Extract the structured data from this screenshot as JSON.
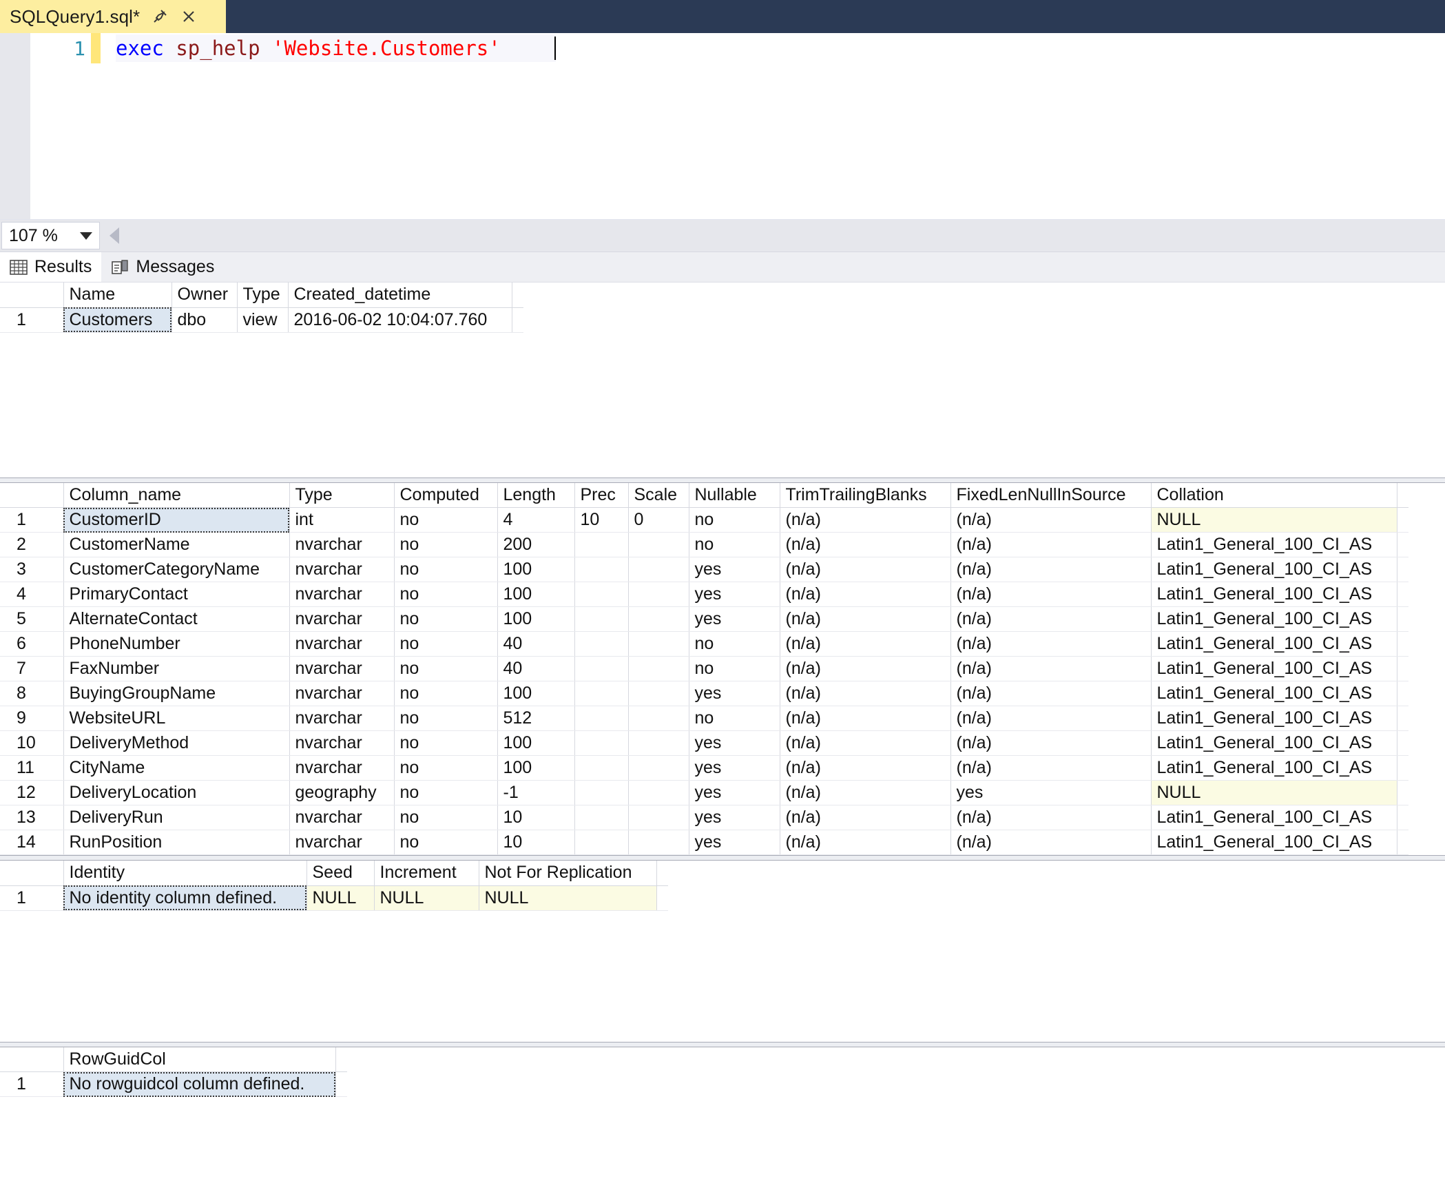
{
  "tab": {
    "title": "SQLQuery1.sql*",
    "pin_icon": "pin-icon",
    "close_icon": "close-icon"
  },
  "editor": {
    "line_number": "1",
    "code": {
      "keyword": "exec",
      "procedure": "sp_help",
      "string": "'Website.Customers'"
    }
  },
  "zoom_bar": {
    "zoom_value": "107 %",
    "dropdown_icon": "chevron-down-icon",
    "splitter_icon": "left-arrow-icon"
  },
  "result_tabs": [
    {
      "label": "Results",
      "icon": "grid-icon",
      "selected": true
    },
    {
      "label": "Messages",
      "icon": "messages-icon",
      "selected": false
    }
  ],
  "grids": [
    {
      "name": "object-info-grid",
      "headers": [
        "",
        "Name",
        "Owner",
        "Type",
        "Created_datetime"
      ],
      "rows": [
        {
          "rownum": "1",
          "cells": [
            {
              "value": "Customers",
              "state": "selected"
            },
            {
              "value": "dbo",
              "state": "normal"
            },
            {
              "value": "view",
              "state": "normal"
            },
            {
              "value": "2016-06-02 10:04:07.760",
              "state": "normal"
            }
          ]
        }
      ]
    },
    {
      "name": "columns-grid",
      "headers": [
        "",
        "Column_name",
        "Type",
        "Computed",
        "Length",
        "Prec",
        "Scale",
        "Nullable",
        "TrimTrailingBlanks",
        "FixedLenNullInSource",
        "Collation"
      ],
      "rows": [
        {
          "rownum": "1",
          "cells": [
            {
              "value": "CustomerID",
              "state": "selected"
            },
            {
              "value": "int",
              "state": "normal"
            },
            {
              "value": "no",
              "state": "normal"
            },
            {
              "value": "4",
              "state": "normal"
            },
            {
              "value": "10",
              "state": "normal"
            },
            {
              "value": "0",
              "state": "normal"
            },
            {
              "value": "no",
              "state": "normal"
            },
            {
              "value": "(n/a)",
              "state": "normal"
            },
            {
              "value": "(n/a)",
              "state": "normal"
            },
            {
              "value": "NULL",
              "state": "null"
            }
          ]
        },
        {
          "rownum": "2",
          "cells": [
            {
              "value": "CustomerName",
              "state": "normal"
            },
            {
              "value": "nvarchar",
              "state": "normal"
            },
            {
              "value": "no",
              "state": "normal"
            },
            {
              "value": "200",
              "state": "normal"
            },
            {
              "value": "",
              "state": "normal"
            },
            {
              "value": "",
              "state": "normal"
            },
            {
              "value": "no",
              "state": "normal"
            },
            {
              "value": "(n/a)",
              "state": "normal"
            },
            {
              "value": "(n/a)",
              "state": "normal"
            },
            {
              "value": "Latin1_General_100_CI_AS",
              "state": "normal"
            }
          ]
        },
        {
          "rownum": "3",
          "cells": [
            {
              "value": "CustomerCategoryName",
              "state": "normal"
            },
            {
              "value": "nvarchar",
              "state": "normal"
            },
            {
              "value": "no",
              "state": "normal"
            },
            {
              "value": "100",
              "state": "normal"
            },
            {
              "value": "",
              "state": "normal"
            },
            {
              "value": "",
              "state": "normal"
            },
            {
              "value": "yes",
              "state": "normal"
            },
            {
              "value": "(n/a)",
              "state": "normal"
            },
            {
              "value": "(n/a)",
              "state": "normal"
            },
            {
              "value": "Latin1_General_100_CI_AS",
              "state": "normal"
            }
          ]
        },
        {
          "rownum": "4",
          "cells": [
            {
              "value": "PrimaryContact",
              "state": "normal"
            },
            {
              "value": "nvarchar",
              "state": "normal"
            },
            {
              "value": "no",
              "state": "normal"
            },
            {
              "value": "100",
              "state": "normal"
            },
            {
              "value": "",
              "state": "normal"
            },
            {
              "value": "",
              "state": "normal"
            },
            {
              "value": "yes",
              "state": "normal"
            },
            {
              "value": "(n/a)",
              "state": "normal"
            },
            {
              "value": "(n/a)",
              "state": "normal"
            },
            {
              "value": "Latin1_General_100_CI_AS",
              "state": "normal"
            }
          ]
        },
        {
          "rownum": "5",
          "cells": [
            {
              "value": "AlternateContact",
              "state": "normal"
            },
            {
              "value": "nvarchar",
              "state": "normal"
            },
            {
              "value": "no",
              "state": "normal"
            },
            {
              "value": "100",
              "state": "normal"
            },
            {
              "value": "",
              "state": "normal"
            },
            {
              "value": "",
              "state": "normal"
            },
            {
              "value": "yes",
              "state": "normal"
            },
            {
              "value": "(n/a)",
              "state": "normal"
            },
            {
              "value": "(n/a)",
              "state": "normal"
            },
            {
              "value": "Latin1_General_100_CI_AS",
              "state": "normal"
            }
          ]
        },
        {
          "rownum": "6",
          "cells": [
            {
              "value": "PhoneNumber",
              "state": "normal"
            },
            {
              "value": "nvarchar",
              "state": "normal"
            },
            {
              "value": "no",
              "state": "normal"
            },
            {
              "value": "40",
              "state": "normal"
            },
            {
              "value": "",
              "state": "normal"
            },
            {
              "value": "",
              "state": "normal"
            },
            {
              "value": "no",
              "state": "normal"
            },
            {
              "value": "(n/a)",
              "state": "normal"
            },
            {
              "value": "(n/a)",
              "state": "normal"
            },
            {
              "value": "Latin1_General_100_CI_AS",
              "state": "normal"
            }
          ]
        },
        {
          "rownum": "7",
          "cells": [
            {
              "value": "FaxNumber",
              "state": "normal"
            },
            {
              "value": "nvarchar",
              "state": "normal"
            },
            {
              "value": "no",
              "state": "normal"
            },
            {
              "value": "40",
              "state": "normal"
            },
            {
              "value": "",
              "state": "normal"
            },
            {
              "value": "",
              "state": "normal"
            },
            {
              "value": "no",
              "state": "normal"
            },
            {
              "value": "(n/a)",
              "state": "normal"
            },
            {
              "value": "(n/a)",
              "state": "normal"
            },
            {
              "value": "Latin1_General_100_CI_AS",
              "state": "normal"
            }
          ]
        },
        {
          "rownum": "8",
          "cells": [
            {
              "value": "BuyingGroupName",
              "state": "normal"
            },
            {
              "value": "nvarchar",
              "state": "normal"
            },
            {
              "value": "no",
              "state": "normal"
            },
            {
              "value": "100",
              "state": "normal"
            },
            {
              "value": "",
              "state": "normal"
            },
            {
              "value": "",
              "state": "normal"
            },
            {
              "value": "yes",
              "state": "normal"
            },
            {
              "value": "(n/a)",
              "state": "normal"
            },
            {
              "value": "(n/a)",
              "state": "normal"
            },
            {
              "value": "Latin1_General_100_CI_AS",
              "state": "normal"
            }
          ]
        },
        {
          "rownum": "9",
          "cells": [
            {
              "value": "WebsiteURL",
              "state": "normal"
            },
            {
              "value": "nvarchar",
              "state": "normal"
            },
            {
              "value": "no",
              "state": "normal"
            },
            {
              "value": "512",
              "state": "normal"
            },
            {
              "value": "",
              "state": "normal"
            },
            {
              "value": "",
              "state": "normal"
            },
            {
              "value": "no",
              "state": "normal"
            },
            {
              "value": "(n/a)",
              "state": "normal"
            },
            {
              "value": "(n/a)",
              "state": "normal"
            },
            {
              "value": "Latin1_General_100_CI_AS",
              "state": "normal"
            }
          ]
        },
        {
          "rownum": "10",
          "cells": [
            {
              "value": "DeliveryMethod",
              "state": "normal"
            },
            {
              "value": "nvarchar",
              "state": "normal"
            },
            {
              "value": "no",
              "state": "normal"
            },
            {
              "value": "100",
              "state": "normal"
            },
            {
              "value": "",
              "state": "normal"
            },
            {
              "value": "",
              "state": "normal"
            },
            {
              "value": "yes",
              "state": "normal"
            },
            {
              "value": "(n/a)",
              "state": "normal"
            },
            {
              "value": "(n/a)",
              "state": "normal"
            },
            {
              "value": "Latin1_General_100_CI_AS",
              "state": "normal"
            }
          ]
        },
        {
          "rownum": "11",
          "cells": [
            {
              "value": "CityName",
              "state": "normal"
            },
            {
              "value": "nvarchar",
              "state": "normal"
            },
            {
              "value": "no",
              "state": "normal"
            },
            {
              "value": "100",
              "state": "normal"
            },
            {
              "value": "",
              "state": "normal"
            },
            {
              "value": "",
              "state": "normal"
            },
            {
              "value": "yes",
              "state": "normal"
            },
            {
              "value": "(n/a)",
              "state": "normal"
            },
            {
              "value": "(n/a)",
              "state": "normal"
            },
            {
              "value": "Latin1_General_100_CI_AS",
              "state": "normal"
            }
          ]
        },
        {
          "rownum": "12",
          "cells": [
            {
              "value": "DeliveryLocation",
              "state": "normal"
            },
            {
              "value": "geography",
              "state": "normal"
            },
            {
              "value": "no",
              "state": "normal"
            },
            {
              "value": "-1",
              "state": "normal"
            },
            {
              "value": "",
              "state": "normal"
            },
            {
              "value": "",
              "state": "normal"
            },
            {
              "value": "yes",
              "state": "normal"
            },
            {
              "value": "(n/a)",
              "state": "normal"
            },
            {
              "value": "yes",
              "state": "normal"
            },
            {
              "value": "NULL",
              "state": "null"
            }
          ]
        },
        {
          "rownum": "13",
          "cells": [
            {
              "value": "DeliveryRun",
              "state": "normal"
            },
            {
              "value": "nvarchar",
              "state": "normal"
            },
            {
              "value": "no",
              "state": "normal"
            },
            {
              "value": "10",
              "state": "normal"
            },
            {
              "value": "",
              "state": "normal"
            },
            {
              "value": "",
              "state": "normal"
            },
            {
              "value": "yes",
              "state": "normal"
            },
            {
              "value": "(n/a)",
              "state": "normal"
            },
            {
              "value": "(n/a)",
              "state": "normal"
            },
            {
              "value": "Latin1_General_100_CI_AS",
              "state": "normal"
            }
          ]
        },
        {
          "rownum": "14",
          "cells": [
            {
              "value": "RunPosition",
              "state": "normal"
            },
            {
              "value": "nvarchar",
              "state": "normal"
            },
            {
              "value": "no",
              "state": "normal"
            },
            {
              "value": "10",
              "state": "normal"
            },
            {
              "value": "",
              "state": "normal"
            },
            {
              "value": "",
              "state": "normal"
            },
            {
              "value": "yes",
              "state": "normal"
            },
            {
              "value": "(n/a)",
              "state": "normal"
            },
            {
              "value": "(n/a)",
              "state": "normal"
            },
            {
              "value": "Latin1_General_100_CI_AS",
              "state": "normal"
            }
          ]
        }
      ]
    },
    {
      "name": "identity-grid",
      "headers": [
        "",
        "Identity",
        "Seed",
        "Increment",
        "Not For Replication"
      ],
      "rows": [
        {
          "rownum": "1",
          "cells": [
            {
              "value": "No identity column defined.",
              "state": "selected"
            },
            {
              "value": "NULL",
              "state": "null"
            },
            {
              "value": "NULL",
              "state": "null"
            },
            {
              "value": "NULL",
              "state": "null"
            }
          ]
        }
      ]
    },
    {
      "name": "rowguidcol-grid",
      "headers": [
        "",
        "RowGuidCol"
      ],
      "rows": [
        {
          "rownum": "1",
          "cells": [
            {
              "value": "No rowguidcol column defined.",
              "state": "selected"
            }
          ]
        }
      ]
    }
  ],
  "colors": {
    "tab_strip_bg": "#2b3a55",
    "active_tab_bg": "#fdeea0",
    "keyword": "#0000ff",
    "procedure": "#8b1a1a",
    "string": "#ff0000",
    "line_number": "#2b91af",
    "null_cell_bg": "#fbfbe3",
    "selected_cell_bg": "#dce6f1",
    "change_bar": "#ffe67a"
  }
}
